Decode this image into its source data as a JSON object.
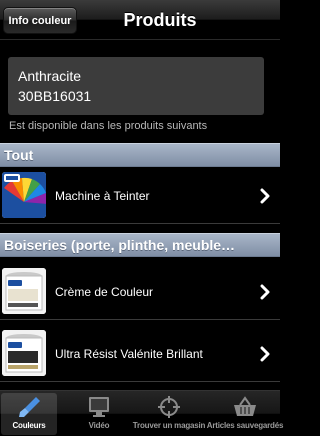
{
  "nav": {
    "back_label": "Info couleur",
    "title": "Produits"
  },
  "color": {
    "name": "Anthracite",
    "code": "30BB16031"
  },
  "available_text": "Est disponible dans les produits suivants",
  "sections": [
    {
      "header": "Tout",
      "items": [
        {
          "label": "Machine à Teinter",
          "icon": "dulux-color-fan-thumb"
        }
      ]
    },
    {
      "header": "Boiseries (porte, plinthe, meuble…",
      "items": [
        {
          "label": "Crème de Couleur",
          "icon": "paint-can-thumb"
        },
        {
          "label": "Ultra Résist Valénite Brillant",
          "icon": "paint-can-thumb"
        }
      ]
    }
  ],
  "tabs": [
    {
      "label": "Couleurs",
      "icon": "brush-icon",
      "active": true
    },
    {
      "label": "Vidéo",
      "icon": "monitor-icon",
      "active": false
    },
    {
      "label": "Trouver un magasin",
      "icon": "crosshair-icon",
      "active": false
    },
    {
      "label": "Articles sauvegardés",
      "icon": "basket-icon",
      "active": false
    }
  ],
  "colors": {
    "section_header": "#8e9cb2",
    "color_box": "#3c3c3c",
    "dulux_blue": "#1c4fa0"
  }
}
